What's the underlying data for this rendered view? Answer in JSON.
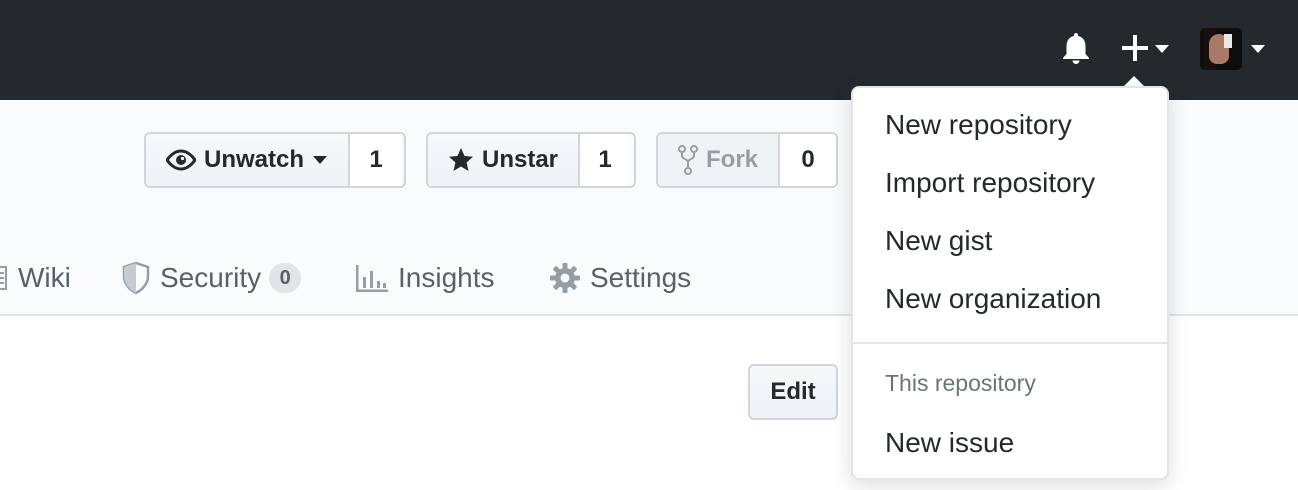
{
  "header": {
    "notifications_icon": "bell-icon",
    "create_icon": "plus-icon",
    "create_caret_icon": "caret-down-icon",
    "avatar_icon": "avatar",
    "colors": {
      "background": "#24292e",
      "icon": "#ffffff"
    }
  },
  "repo_actions": {
    "watch": {
      "label": "Unwatch",
      "count": "1",
      "icon": "eye-icon"
    },
    "star": {
      "label": "Unstar",
      "count": "1",
      "icon": "star-icon"
    },
    "fork": {
      "label": "Fork",
      "count": "0",
      "icon": "repo-forked-icon"
    }
  },
  "tabs": [
    {
      "label": "Wiki",
      "icon": "book-icon"
    },
    {
      "label": "Security",
      "icon": "shield-icon",
      "counter": "0"
    },
    {
      "label": "Insights",
      "icon": "graph-icon"
    },
    {
      "label": "Settings",
      "icon": "gear-icon"
    }
  ],
  "main": {
    "edit_label": "Edit"
  },
  "create_menu": {
    "items": [
      {
        "label": "New repository"
      },
      {
        "label": "Import repository"
      },
      {
        "label": "New gist"
      },
      {
        "label": "New organization"
      }
    ],
    "section_header": "This repository",
    "section_items": [
      {
        "label": "New issue"
      }
    ]
  }
}
